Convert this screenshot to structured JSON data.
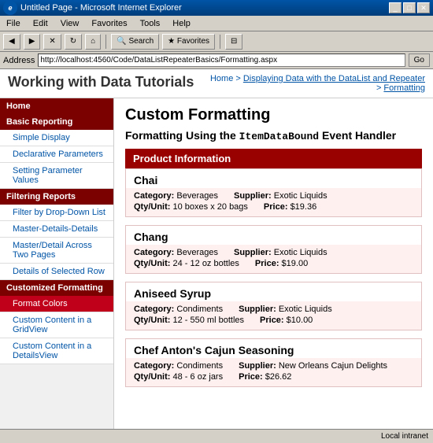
{
  "window": {
    "title": "Untitled Page - Microsoft Internet Explorer",
    "icon": "ie"
  },
  "menu": {
    "items": [
      "File",
      "Edit",
      "View",
      "Favorites",
      "Tools",
      "Help"
    ]
  },
  "toolbar": {
    "back_label": "◀",
    "forward_label": "▶",
    "stop_label": "✕",
    "refresh_label": "↻",
    "home_label": "🏠",
    "search_label": "Search",
    "favorites_label": "Favorites",
    "history_label": "⊟"
  },
  "address_bar": {
    "label": "Address",
    "url": "http://localhost:4560/Code/DataListRepeaterBasics/Formatting.aspx",
    "go_label": "Go"
  },
  "page_header": {
    "title": "Working with Data Tutorials",
    "breadcrumb_home": "Home",
    "breadcrumb_sep": " > ",
    "breadcrumb_parent": "Displaying Data with the DataList and Repeater",
    "breadcrumb_current": "Formatting"
  },
  "sidebar": {
    "home_label": "Home",
    "sections": [
      {
        "header": "Basic Reporting",
        "items": [
          {
            "label": "Simple Display",
            "active": false
          },
          {
            "label": "Declarative Parameters",
            "active": false
          },
          {
            "label": "Setting Parameter Values",
            "active": false
          }
        ]
      },
      {
        "header": "Filtering Reports",
        "items": [
          {
            "label": "Filter by Drop-Down List",
            "active": false
          },
          {
            "label": "Master-Details-Details",
            "active": false
          },
          {
            "label": "Master/Detail Across Two Pages",
            "active": false
          },
          {
            "label": "Details of Selected Row",
            "active": false
          }
        ]
      },
      {
        "header": "Customized Formatting",
        "items": [
          {
            "label": "Format Colors",
            "active": false
          },
          {
            "label": "Custom Content in a GridView",
            "active": false
          },
          {
            "label": "Custom Content in a DetailsView",
            "active": false
          }
        ]
      }
    ]
  },
  "content": {
    "heading": "Custom Formatting",
    "subheading_prefix": "Formatting Using the ",
    "subheading_code": "ItemDataBound",
    "subheading_suffix": " Event Handler",
    "product_section_title": "Product Information",
    "products": [
      {
        "name": "Chai",
        "category_label": "Category:",
        "category": "Beverages",
        "supplier_label": "Supplier:",
        "supplier": "Exotic Liquids",
        "qty_label": "Qty/Unit:",
        "qty": "10 boxes x 20 bags",
        "price_label": "Price:",
        "price": "$19.36"
      },
      {
        "name": "Chang",
        "category_label": "Category:",
        "category": "Beverages",
        "supplier_label": "Supplier:",
        "supplier": "Exotic Liquids",
        "qty_label": "Qty/Unit:",
        "qty": "24 - 12 oz bottles",
        "price_label": "Price:",
        "price": "$19.00"
      },
      {
        "name": "Aniseed Syrup",
        "category_label": "Category:",
        "category": "Condiments",
        "supplier_label": "Supplier:",
        "supplier": "Exotic Liquids",
        "qty_label": "Qty/Unit:",
        "qty": "12 - 550 ml bottles",
        "price_label": "Price:",
        "price": "$10.00"
      },
      {
        "name": "Chef Anton's Cajun Seasoning",
        "category_label": "Category:",
        "category": "Condiments",
        "supplier_label": "Supplier:",
        "supplier": "New Orleans Cajun Delights",
        "qty_label": "Qty/Unit:",
        "qty": "48 - 6 oz jars",
        "price_label": "Price:",
        "price": "$26.62"
      }
    ]
  },
  "status_bar": {
    "status": "Local intranet"
  }
}
